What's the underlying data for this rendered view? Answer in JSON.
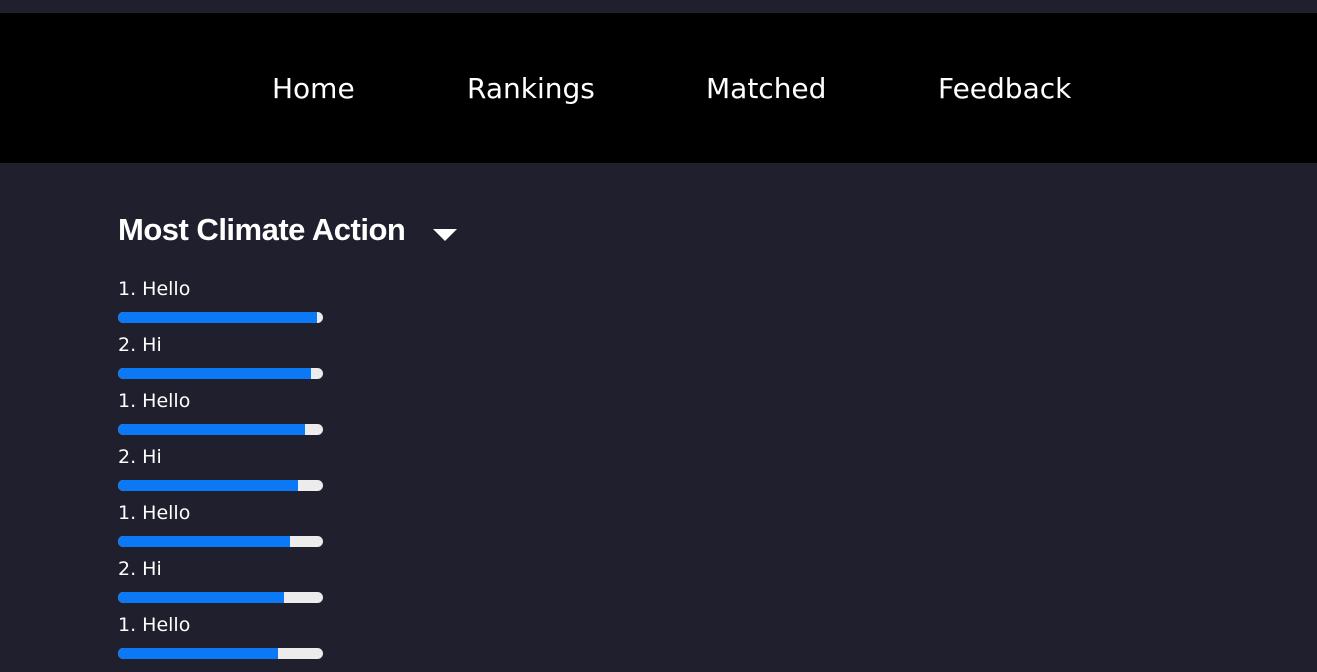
{
  "nav": {
    "items": [
      {
        "label": "Home"
      },
      {
        "label": "Rankings"
      },
      {
        "label": "Matched"
      },
      {
        "label": "Feedback"
      }
    ]
  },
  "section": {
    "title": "Most Climate Action",
    "dropdown_icon": "caret-down-icon"
  },
  "rankings": [
    {
      "label": "1. Hello",
      "progress": 0.97
    },
    {
      "label": "2. Hi",
      "progress": 0.94
    },
    {
      "label": "1. Hello",
      "progress": 0.91
    },
    {
      "label": "2. Hi",
      "progress": 0.88
    },
    {
      "label": "1. Hello",
      "progress": 0.84
    },
    {
      "label": "2. Hi",
      "progress": 0.81
    },
    {
      "label": "1. Hello",
      "progress": 0.78
    }
  ],
  "colors": {
    "page_background": "#1f1f2e",
    "navbar_background": "#000000",
    "bar_fill": "#0b78f5",
    "bar_track": "#ececec",
    "text": "#ffffff"
  }
}
